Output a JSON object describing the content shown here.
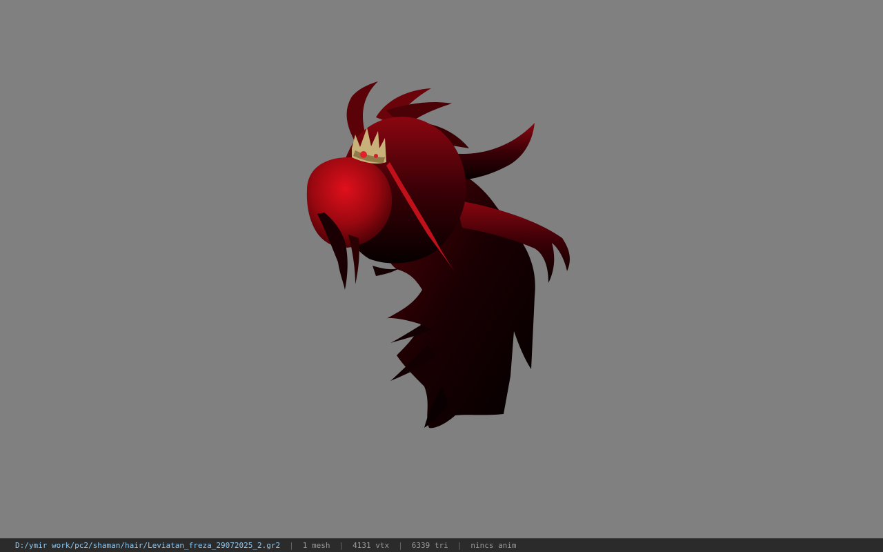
{
  "viewport": {
    "background_color": "#808080",
    "model": {
      "subject": "hair-mesh",
      "colors": {
        "hair_bright": "#b40a14",
        "hair_dark": "#3a0005",
        "crown_gold": "#c9b27a",
        "gem_red": "#e0202a"
      }
    }
  },
  "status_bar": {
    "background_color": "#2b2b2b",
    "path_color": "#8ec8f0",
    "file_path": "D:/ymir work/pc2/shaman/hair/Leviatan_freza_29072025_2.gr2",
    "separator": "|",
    "mesh_count": "1 mesh",
    "vertex_count": "4131 vtx",
    "triangle_count": "6339 tri",
    "animation": "nincs anim"
  }
}
